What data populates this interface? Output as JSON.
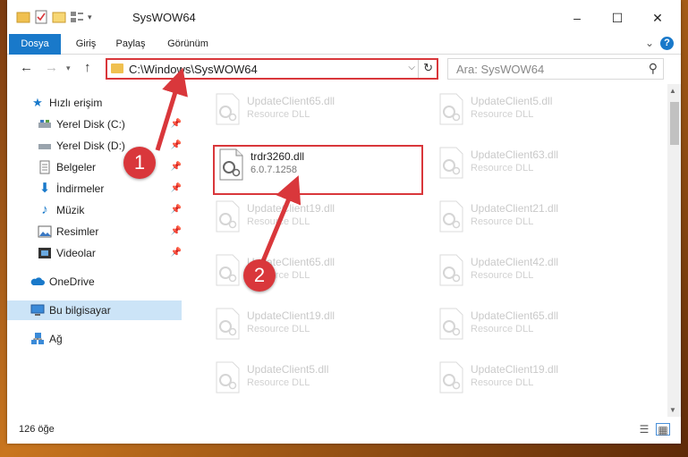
{
  "window": {
    "title": "SysWOW64",
    "controls": {
      "minimize": "–",
      "maximize": "☐",
      "close": "✕"
    }
  },
  "ribbon": {
    "tabs": [
      "Dosya",
      "Giriş",
      "Paylaş",
      "Görünüm"
    ],
    "help": "?"
  },
  "address": {
    "path": "C:\\Windows\\SysWOW64",
    "search_placeholder": "Ara: SysWOW64"
  },
  "sidebar": {
    "items": [
      {
        "label": "Hızlı erişim",
        "icon": "star-icon",
        "pinned": false
      },
      {
        "label": "Yerel Disk (C:)",
        "icon": "drive-icon",
        "pinned": true
      },
      {
        "label": "Yerel Disk (D:)",
        "icon": "drive-icon",
        "pinned": true
      },
      {
        "label": "Belgeler",
        "icon": "document-icon",
        "pinned": true
      },
      {
        "label": "İndirmeler",
        "icon": "download-icon",
        "pinned": true
      },
      {
        "label": "Müzik",
        "icon": "music-icon",
        "pinned": true
      },
      {
        "label": "Resimler",
        "icon": "picture-icon",
        "pinned": true
      },
      {
        "label": "Videolar",
        "icon": "video-icon",
        "pinned": true
      },
      {
        "label": "OneDrive",
        "icon": "cloud-icon",
        "pinned": false
      },
      {
        "label": "Bu bilgisayar",
        "icon": "computer-icon",
        "pinned": false,
        "selected": true
      },
      {
        "label": "Ağ",
        "icon": "network-icon",
        "pinned": false
      }
    ]
  },
  "files": [
    {
      "name": "UpdateClient65.dll",
      "type": "Resource DLL"
    },
    {
      "name": "UpdateClient5.dll",
      "type": "Resource DLL"
    },
    {
      "name": "trdr3260.dll",
      "type": "6.0.7.1258",
      "highlighted": true
    },
    {
      "name": "UpdateClient63.dll",
      "type": "Resource DLL"
    },
    {
      "name": "UpdateClient19.dll",
      "type": "Resource DLL"
    },
    {
      "name": "UpdateClient21.dll",
      "type": "Resource DLL"
    },
    {
      "name": "UpdateClient65.dll",
      "type": "Resource DLL"
    },
    {
      "name": "UpdateClient42.dll",
      "type": "Resource DLL"
    },
    {
      "name": "UpdateClient19.dll",
      "type": "Resource DLL"
    },
    {
      "name": "UpdateClient65.dll",
      "type": "Resource DLL"
    },
    {
      "name": "UpdateClient5.dll",
      "type": "Resource DLL"
    },
    {
      "name": "UpdateClient19.dll",
      "type": "Resource DLL"
    }
  ],
  "status": {
    "item_count": "126 öğe"
  },
  "annotations": {
    "step1": "1",
    "step2": "2",
    "color": "#d9373b"
  }
}
